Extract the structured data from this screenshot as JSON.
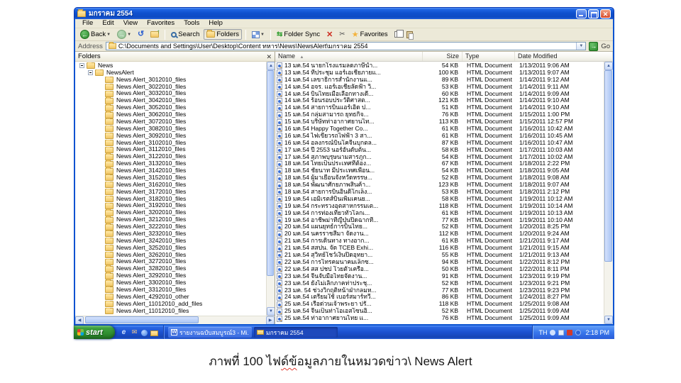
{
  "colors": {
    "titlebar_blue": "#0f51cf",
    "taskbar_blue": "#1c51cf",
    "start_green": "#2f8e2f",
    "window_chrome": "#ece9d8",
    "squiggle_red": "#e03a2f"
  },
  "titlebar": {
    "title": "มกราคม 2554"
  },
  "menubar": {
    "items": [
      "File",
      "Edit",
      "View",
      "Favorites",
      "Tools",
      "Help"
    ]
  },
  "toolbar": {
    "back": "Back",
    "search": "Search",
    "folders": "Folders",
    "folder_sync": "Folder Sync",
    "favorites": "Favorites"
  },
  "addressbar": {
    "label": "Address",
    "path": "C:\\Documents and Settings\\User\\Desktop\\Content ทหาร\\News\\NewsAlert\\มกราคม 2554",
    "go": "Go"
  },
  "folders_pane": {
    "header": "Folders",
    "tree": [
      {
        "label": "News",
        "level": 0,
        "expand": "minus"
      },
      {
        "label": "NewsAlert",
        "level": 1,
        "expand": "minus"
      },
      {
        "label": "News Alert_3012010_files",
        "level": 2,
        "expand": ""
      },
      {
        "label": "News Alert_3022010_files",
        "level": 2,
        "expand": ""
      },
      {
        "label": "News Alert_3032010_files",
        "level": 2,
        "expand": ""
      },
      {
        "label": "News Alert_3042010_files",
        "level": 2,
        "expand": ""
      },
      {
        "label": "News Alert_3052010_files",
        "level": 2,
        "expand": ""
      },
      {
        "label": "News Alert_3062010_files",
        "level": 2,
        "expand": ""
      },
      {
        "label": "News Alert_3072010_files",
        "level": 2,
        "expand": ""
      },
      {
        "label": "News Alert_3082010_files",
        "level": 2,
        "expand": ""
      },
      {
        "label": "News Alert_3092010_files",
        "level": 2,
        "expand": ""
      },
      {
        "label": "News Alert_3102010_files",
        "level": 2,
        "expand": ""
      },
      {
        "label": "News Alert_3112010_files",
        "level": 2,
        "expand": ""
      },
      {
        "label": "News Alert_3122010_files",
        "level": 2,
        "expand": ""
      },
      {
        "label": "News Alert_3132010_files",
        "level": 2,
        "expand": ""
      },
      {
        "label": "News Alert_3142010_files",
        "level": 2,
        "expand": ""
      },
      {
        "label": "News Alert_3152010_files",
        "level": 2,
        "expand": ""
      },
      {
        "label": "News Alert_3162010_files",
        "level": 2,
        "expand": ""
      },
      {
        "label": "News Alert_3172010_files",
        "level": 2,
        "expand": ""
      },
      {
        "label": "News Alert_3182010_files",
        "level": 2,
        "expand": ""
      },
      {
        "label": "News Alert_3192010_files",
        "level": 2,
        "expand": ""
      },
      {
        "label": "News Alert_3202010_files",
        "level": 2,
        "expand": ""
      },
      {
        "label": "News Alert_3212010_files",
        "level": 2,
        "expand": ""
      },
      {
        "label": "News Alert_3222010_files",
        "level": 2,
        "expand": ""
      },
      {
        "label": "News Alert_3232010_files",
        "level": 2,
        "expand": ""
      },
      {
        "label": "News Alert_3242010_files",
        "level": 2,
        "expand": ""
      },
      {
        "label": "News Alert_3252010_files",
        "level": 2,
        "expand": ""
      },
      {
        "label": "News Alert_3262010_files",
        "level": 2,
        "expand": ""
      },
      {
        "label": "News Alert_3272010_files",
        "level": 2,
        "expand": ""
      },
      {
        "label": "News Alert_3282010_files",
        "level": 2,
        "expand": ""
      },
      {
        "label": "News Alert_3292010_files",
        "level": 2,
        "expand": ""
      },
      {
        "label": "News Alert_3302010_files",
        "level": 2,
        "expand": ""
      },
      {
        "label": "News Alert_3312010_files",
        "level": 2,
        "expand": ""
      },
      {
        "label": "News Alert_4292010_other",
        "level": 2,
        "expand": ""
      },
      {
        "label": "News Alert_11012010_add_files",
        "level": 2,
        "expand": ""
      },
      {
        "label": "News Alert_11012010_files",
        "level": 2,
        "expand": ""
      }
    ]
  },
  "file_list": {
    "columns": [
      "Name",
      "Size",
      "Type",
      "Date Modified"
    ],
    "rows": [
      {
        "name": "13 มค.54 นายกโรงแรมลดภาษีน้ำ...",
        "size": "54 KB",
        "type": "HTML Document",
        "modified": "1/13/2011 9:06 AM"
      },
      {
        "name": "13 มค.54 ที่ประชุม แอร์เอเชียภายแ...",
        "size": "100 KB",
        "type": "HTML Document",
        "modified": "1/13/2011 9:07 AM"
      },
      {
        "name": "14 มค.54 เลขาธิการสำนักงานแ...",
        "size": "89 KB",
        "type": "HTML Document",
        "modified": "1/14/2011 9:12 AM"
      },
      {
        "name": "14 มค.54 อจร. แอร์เอเชียลัดฟ้า วิ...",
        "size": "53 KB",
        "type": "HTML Document",
        "modified": "1/14/2011 9:11 AM"
      },
      {
        "name": "14 มค.54 บินไทยเมื่อเลือกทางเดี...",
        "size": "60 KB",
        "type": "HTML Document",
        "modified": "1/14/2011 9:09 AM"
      },
      {
        "name": "14 มค.54 ร้อนรอบประวัติศาสต...",
        "size": "121 KB",
        "type": "HTML Document",
        "modified": "1/14/2011 9:10 AM"
      },
      {
        "name": "14 มค.54 สายการบินแอร์เอิด ป...",
        "size": "51 KB",
        "type": "HTML Document",
        "modified": "1/14/2011 9:10 AM"
      },
      {
        "name": "15 มค.54 กลุ่มสามารถ ยุทธกิจ...",
        "size": "76 KB",
        "type": "HTML Document",
        "modified": "1/15/2011 1:00 PM"
      },
      {
        "name": "15 มค.54 บริษัทท่าอากาศยานไท...",
        "size": "113 KB",
        "type": "HTML Document",
        "modified": "1/15/2011 12:57 PM"
      },
      {
        "name": "16 มค.54 Happy Together Co...",
        "size": "61 KB",
        "type": "HTML Document",
        "modified": "1/16/2011 10:42 AM"
      },
      {
        "name": "16 มค.54 ไฟเขียวรถไฟฟ้า 3 สา...",
        "size": "61 KB",
        "type": "HTML Document",
        "modified": "1/16/2011 10:45 AM"
      },
      {
        "name": "16 มค.54 อลงกรณ์บินโคจีนบุกตล...",
        "size": "87 KB",
        "type": "HTML Document",
        "modified": "1/16/2011 10:47 AM"
      },
      {
        "name": "17 มค.54 ปี 2553 นอร์อันดับต้น...",
        "size": "58 KB",
        "type": "HTML Document",
        "modified": "1/17/2011 10:03 AM"
      },
      {
        "name": "17 มค.54 สุภาพบุรุษนามสารภูก...",
        "size": "54 KB",
        "type": "HTML Document",
        "modified": "1/17/2011 10:02 AM"
      },
      {
        "name": "18 มค.54 ไทยเป็นประเทศที่ต้อง...",
        "size": "67 KB",
        "type": "HTML Document",
        "modified": "1/18/2011 2:22 PM"
      },
      {
        "name": "18 มค.54 ชัยนาท มีประเทศเพื่อน...",
        "size": "54 KB",
        "type": "HTML Document",
        "modified": "1/18/2011 9:05 AM"
      },
      {
        "name": "18 มค.54 ผู้มาเยือนจังหวัดหรรษ...",
        "size": "52 KB",
        "type": "HTML Document",
        "modified": "1/18/2011 9:08 AM"
      },
      {
        "name": "18 มค.54 พัฒนาศักยภาพสินค้า...",
        "size": "123 KB",
        "type": "HTML Document",
        "modified": "1/18/2011 9:07 AM"
      },
      {
        "name": "18 มค.54 สายการบินอินดิโกเล็ง...",
        "size": "53 KB",
        "type": "HTML Document",
        "modified": "1/18/2011 2:12 PM"
      },
      {
        "name": "19 มค.54 เอมิเรตส์บินเพิ่มเคนย...",
        "size": "58 KB",
        "type": "HTML Document",
        "modified": "1/19/2011 10:12 AM"
      },
      {
        "name": "19 มค.54 กระทรวงอุตสาหกรรมเต...",
        "size": "118 KB",
        "type": "HTML Document",
        "modified": "1/19/2011 10:14 AM"
      },
      {
        "name": "19 มค.54 การท่องเที่ยวทั่วโลกเ...",
        "size": "61 KB",
        "type": "HTML Document",
        "modified": "1/19/2011 10:13 AM"
      },
      {
        "name": "19 มค.54 อาชีพม่าที่ญี่ปุ่นปิดฉากที่...",
        "size": "77 KB",
        "type": "HTML Document",
        "modified": "1/19/2011 10:10 AM"
      },
      {
        "name": "20 มค.54 แผนยุทธ์การบินไทย...",
        "size": "52 KB",
        "type": "HTML Document",
        "modified": "1/20/2011 8:25 PM"
      },
      {
        "name": "20 มค.54 นครราชสีมา จัดงาน...",
        "size": "112 KB",
        "type": "HTML Document",
        "modified": "1/20/2011 9:24 AM"
      },
      {
        "name": "21 มค.54 การเดินทาง ทางอาก...",
        "size": "61 KB",
        "type": "HTML Document",
        "modified": "1/21/2011 9:17 AM"
      },
      {
        "name": "21 มค.54 สสปน. จัด TCEB Exhi...",
        "size": "116 KB",
        "type": "HTML Document",
        "modified": "1/21/2011 9:15 AM"
      },
      {
        "name": "21 มค.54 สุวิทย์โชว์เงินปิดอุทยา...",
        "size": "55 KB",
        "type": "HTML Document",
        "modified": "1/21/2011 9:13 AM"
      },
      {
        "name": "22 มค.54 การโทรคมนาคมเล็กซ...",
        "size": "94 KB",
        "type": "HTML Document",
        "modified": "1/22/2011 8:12 PM"
      },
      {
        "name": "22 มค.54 สส ปชป โวยตั๋วเครื่อ...",
        "size": "50 KB",
        "type": "HTML Document",
        "modified": "1/22/2011 8:11 PM"
      },
      {
        "name": "23 มค.54 จีนจับมือไทยจัดงาน...",
        "size": "91 KB",
        "type": "HTML Document",
        "modified": "1/23/2011 9:19 PM"
      },
      {
        "name": "23 มค.54 ยังไม่เลิกภาคท่าประชุ...",
        "size": "52 KB",
        "type": "HTML Document",
        "modified": "1/23/2011 9:21 PM"
      },
      {
        "name": "23 มค. 54 ช่วงวิกฤติหน้าฝ่ากลมห...",
        "size": "77 KB",
        "type": "HTML Document",
        "modified": "1/23/2011 9:23 PM"
      },
      {
        "name": "24 มค.54 เตรียมใช้ เบอร์สมาร์ทวี...",
        "size": "86 KB",
        "type": "HTML Document",
        "modified": "1/24/2011 8:27 PM"
      },
      {
        "name": "25 มค.54 เรือด่วนเจ้าพระยา ปรั...",
        "size": "118 KB",
        "type": "HTML Document",
        "modified": "1/25/2011 9:08 AM"
      },
      {
        "name": "25 มค.54 จีนเป็นท่าโอเอสโซนอิ...",
        "size": "52 KB",
        "type": "HTML Document",
        "modified": "1/25/2011 9:09 AM"
      },
      {
        "name": "25 มค.54 ท่าอากาศยานไทย แ...",
        "size": "76 KB",
        "type": "HTML Document",
        "modified": "1/25/2011 9:09 AM"
      }
    ]
  },
  "taskbar": {
    "start": "start",
    "buttons": [
      {
        "label": "รายงานฉบับสมบูรณ์3 - Mi...",
        "icon": "word",
        "active": "false"
      },
      {
        "label": "มกราคม 2554",
        "icon": "folder",
        "active": "true"
      }
    ],
    "tray": {
      "language": "TH",
      "time": "2:18 PM"
    }
  },
  "caption": {
    "before": "ภาพที่ 100 ไฟ",
    "underlined": "ด์ข้",
    "after": "อมูลภายในหมวดข่าว\\ News Alert"
  }
}
